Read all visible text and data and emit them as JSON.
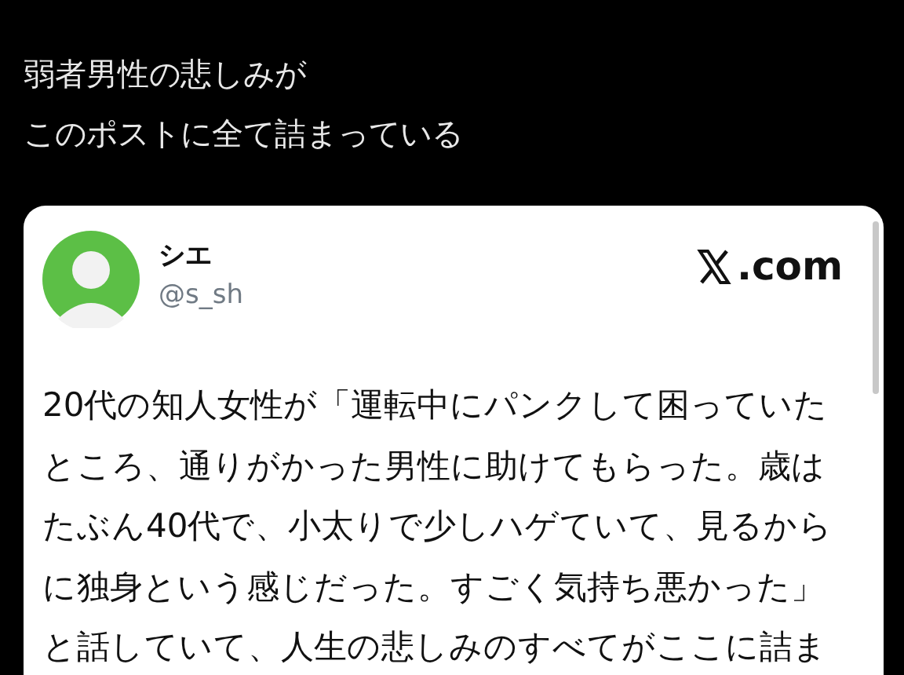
{
  "caption": [
    "弱者男性の悲しみが",
    "このポストに全て詰まっている"
  ],
  "post": {
    "author": {
      "name": "シエ",
      "handle": "@s_sh"
    },
    "source": ".com",
    "text_lines": [
      "20代の知人女性が「運転中にパンクして困っていた",
      "ところ、通りがかった男性に助けてもらった。歳は",
      "たぶん40代で、小太りで少しハゲていて、見るから",
      "に独身という感じだった。すごく気持ち悪かった」",
      "と話していて、人生の悲しみのすべてがここに詰ま"
    ]
  }
}
